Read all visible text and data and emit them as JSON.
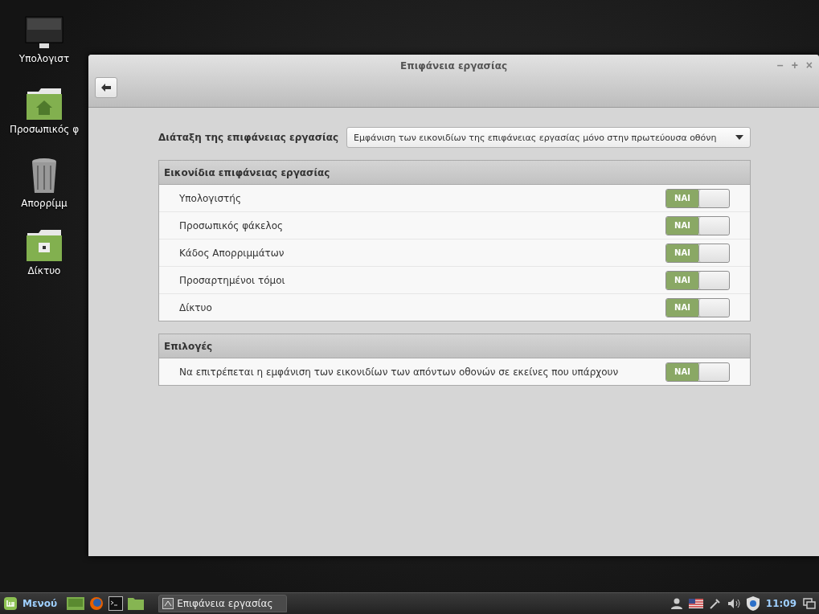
{
  "desktop_icons": [
    {
      "kind": "computer",
      "label": "Υπολογιστ"
    },
    {
      "kind": "home",
      "label": "Προσωπικός φ"
    },
    {
      "kind": "trash",
      "label": "Απορρίμμ"
    },
    {
      "kind": "network",
      "label": "Δίκτυο"
    }
  ],
  "window": {
    "title": "Επιφάνεια εργασίας",
    "controls": [
      "–",
      "+",
      "×"
    ]
  },
  "layout": {
    "label": "Διάταξη της επιφάνειας εργασίας",
    "value": "Εμφάνιση των εικονιδίων της επιφάνειας εργασίας μόνο στην πρωτεύουσα οθόνη"
  },
  "sections": [
    {
      "title": "Εικονίδια επιφάνειας εργασίας",
      "rows": [
        {
          "label": "Υπολογιστής",
          "on": true,
          "switch_text": "NAI"
        },
        {
          "label": "Προσωπικός φάκελος",
          "on": true,
          "switch_text": "NAI"
        },
        {
          "label": "Κάδος Απορριμμάτων",
          "on": true,
          "switch_text": "NAI"
        },
        {
          "label": "Προσαρτημένοι τόμοι",
          "on": true,
          "switch_text": "NAI"
        },
        {
          "label": "Δίκτυο",
          "on": true,
          "switch_text": "NAI"
        }
      ]
    },
    {
      "title": "Επιλογές",
      "rows": [
        {
          "label": "Να επιτρέπεται η εμφάνιση των εικονιδίων των απόντων οθονών σε εκείνες που υπάρχουν",
          "on": true,
          "switch_text": "NAI"
        }
      ]
    }
  ],
  "taskbar": {
    "menu_label": "Μενού",
    "task": "Επιφάνεια εργασίας",
    "clock": "11:09"
  }
}
